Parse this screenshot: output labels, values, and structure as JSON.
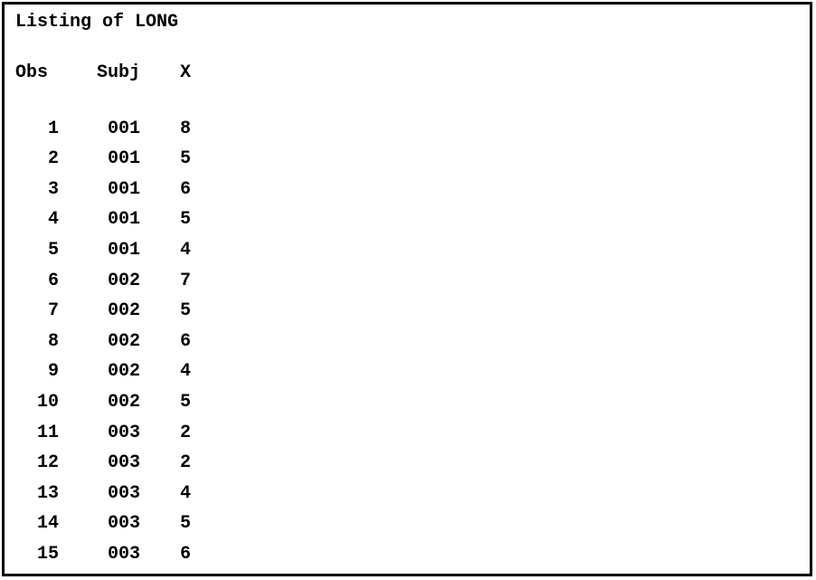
{
  "title": "Listing of LONG",
  "headers": {
    "obs": "Obs",
    "subj": "Subj",
    "x": "X"
  },
  "rows": [
    {
      "obs": "1",
      "subj": "001",
      "x": "8"
    },
    {
      "obs": "2",
      "subj": "001",
      "x": "5"
    },
    {
      "obs": "3",
      "subj": "001",
      "x": "6"
    },
    {
      "obs": "4",
      "subj": "001",
      "x": "5"
    },
    {
      "obs": "5",
      "subj": "001",
      "x": "4"
    },
    {
      "obs": "6",
      "subj": "002",
      "x": "7"
    },
    {
      "obs": "7",
      "subj": "002",
      "x": "5"
    },
    {
      "obs": "8",
      "subj": "002",
      "x": "6"
    },
    {
      "obs": "9",
      "subj": "002",
      "x": "4"
    },
    {
      "obs": "10",
      "subj": "002",
      "x": "5"
    },
    {
      "obs": "11",
      "subj": "003",
      "x": "2"
    },
    {
      "obs": "12",
      "subj": "003",
      "x": "2"
    },
    {
      "obs": "13",
      "subj": "003",
      "x": "4"
    },
    {
      "obs": "14",
      "subj": "003",
      "x": "5"
    },
    {
      "obs": "15",
      "subj": "003",
      "x": "6"
    }
  ]
}
